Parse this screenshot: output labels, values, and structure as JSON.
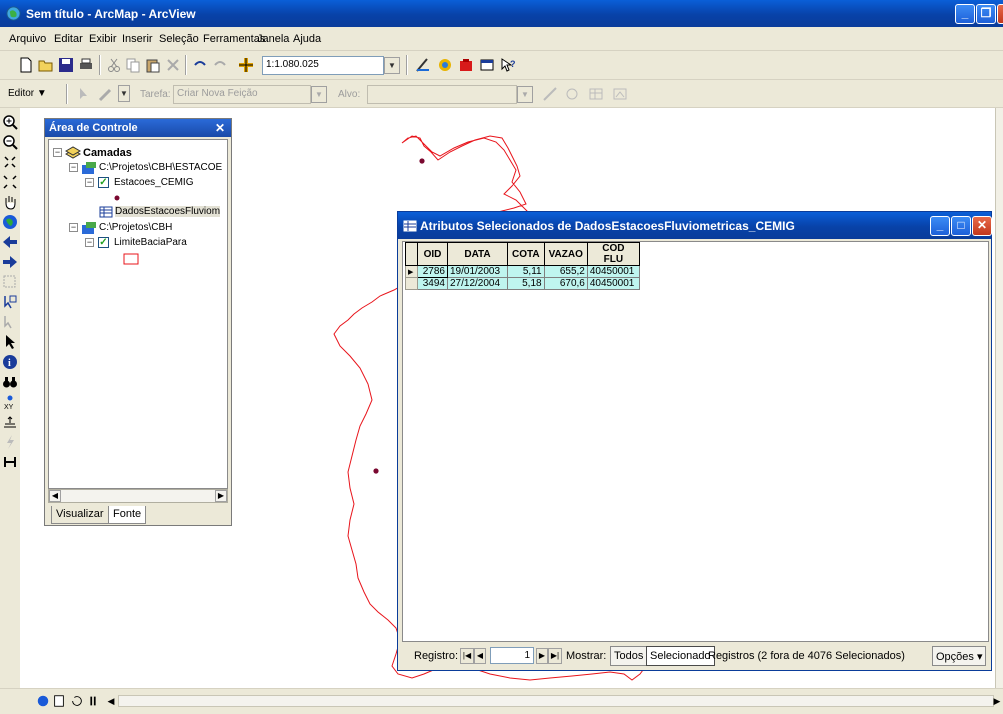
{
  "window": {
    "title": "Sem título - ArcMap - ArcView"
  },
  "menu": {
    "items": [
      "Arquivo",
      "Editar",
      "Exibir",
      "Inserir",
      "Seleção",
      "Ferramentas",
      "Janela",
      "Ajuda"
    ]
  },
  "toolbar": {
    "scale_value": "1:1.080.025"
  },
  "editor_toolbar": {
    "editor_label": "Editor ▼",
    "task_label": "Tarefa:",
    "task_value": "Criar Nova Feição",
    "target_label": "Alvo:",
    "target_value": ""
  },
  "toc": {
    "title": "Área de Controle",
    "root_label": "Camadas",
    "items": [
      {
        "label": "C:\\Projetos\\CBH\\ESTACOE"
      },
      {
        "label": "Estacoes_CEMIG"
      },
      {
        "label": "DadosEstacoesFluviom"
      },
      {
        "label": "C:\\Projetos\\CBH"
      },
      {
        "label": "LimiteBaciaPara"
      }
    ],
    "tabs": [
      "Visualizar",
      "Fonte"
    ]
  },
  "attributes": {
    "title": "Atributos Selecionados de DadosEstacoesFluviometricas_CEMIG",
    "columns": [
      "OID",
      "DATA",
      "COTA",
      "VAZAO",
      "COD FLU"
    ],
    "rows": [
      {
        "oid": "2786",
        "data": "19/01/2003",
        "cota": "5,11",
        "vazao": "655,2",
        "cod_flu": "40450001"
      },
      {
        "oid": "3494",
        "data": "27/12/2004",
        "cota": "5,18",
        "vazao": "670,6",
        "cod_flu": "40450001"
      }
    ],
    "record_label": "Registro:",
    "record_value": "1",
    "show_label": "Mostrar:",
    "all_button": "Todos",
    "selected_button": "Selecionado",
    "records_status": "Registros (2 fora de  4076 Selecionados)",
    "options_button": "Opções ▾"
  },
  "colors": {
    "titlebar": "#0a4fd0",
    "chrome": "#ece9d8",
    "table_row": "#bff5ef",
    "boundary": "#e8141b",
    "station_point": "#7a0830"
  }
}
